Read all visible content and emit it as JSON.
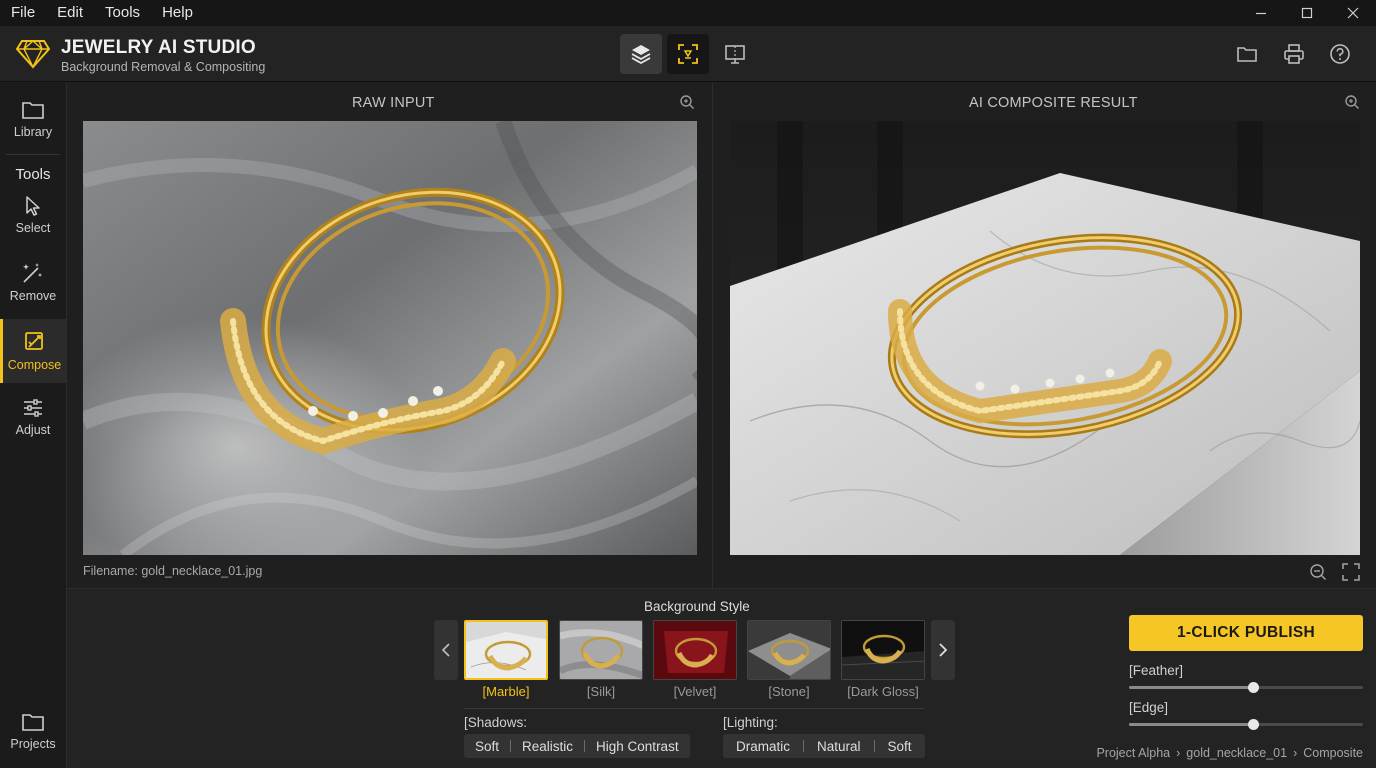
{
  "menubar": {
    "items": [
      "File",
      "Edit",
      "Tools",
      "Help"
    ]
  },
  "header": {
    "title": "JEWELRY AI STUDIO",
    "subtitle": "Background Removal & Compositing"
  },
  "sidebar": {
    "library_label": "Library",
    "tools_heading": "Tools",
    "tools": [
      {
        "label": "Select",
        "icon": "cursor-icon",
        "active": false
      },
      {
        "label": "Remove",
        "icon": "wand-icon",
        "active": false
      },
      {
        "label": "Compose",
        "icon": "compose-icon",
        "active": true
      },
      {
        "label": "Adjust",
        "icon": "sliders-icon",
        "active": false
      }
    ],
    "projects_label": "Projects"
  },
  "panels": {
    "left_title": "RAW INPUT",
    "right_title": "AI COMPOSITE RESULT",
    "filename": "Filename: gold_necklace_01.jpg"
  },
  "background_style": {
    "title": "Background Style",
    "options": [
      {
        "label": "[Marble]",
        "selected": true
      },
      {
        "label": "[Silk]",
        "selected": false
      },
      {
        "label": "[Velvet]",
        "selected": false
      },
      {
        "label": "[Stone]",
        "selected": false
      },
      {
        "label": "[Dark Gloss]",
        "selected": false
      }
    ]
  },
  "shadows": {
    "title": "[Shadows:",
    "options": [
      "Soft",
      "Realistic",
      "High Contrast"
    ]
  },
  "lighting": {
    "title": "[Lighting:",
    "options": [
      "Dramatic",
      "Natural",
      "Soft"
    ]
  },
  "publish_label": "1-CLICK PUBLISH",
  "sliders": {
    "feather_label": "[Feather]",
    "feather_value": 0.53,
    "edge_label": "[Edge]",
    "edge_value": 0.53
  },
  "breadcrumb": [
    "Project Alpha",
    "gold_necklace_01",
    "Composite"
  ],
  "colors": {
    "accent": "#f5c624",
    "background": "#1f1f1f"
  }
}
